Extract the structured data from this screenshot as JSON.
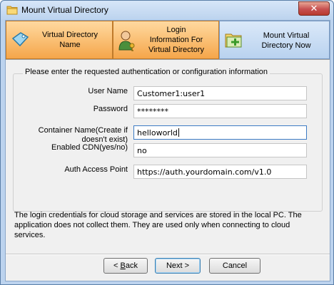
{
  "window": {
    "title": "Mount Virtual Directory",
    "close_glyph": "✕"
  },
  "steps": [
    {
      "label_line1": "Virtual Directory",
      "label_line2": "Name",
      "icon": "tag-icon",
      "state": "done"
    },
    {
      "label_line1": "Login",
      "label_line2": "Information For",
      "label_line3": "Virtual Directory",
      "icon": "user-key-icon",
      "state": "current"
    },
    {
      "label_line1": "Mount Virtual",
      "label_line2": "Directory Now",
      "icon": "folder-add-icon",
      "state": "pending"
    }
  ],
  "form": {
    "group_title": "Please enter the requested authentication or configuration information",
    "username_label": "User Name",
    "username_value": "Customer1:user1",
    "password_label": "Password",
    "password_value": "********",
    "container_label_line1": "Container Name(Create if",
    "container_label_line2": "doesn't exist)",
    "container_value": "helloworld",
    "cdn_label": "Enabled CDN(yes/no)",
    "cdn_value": "no",
    "auth_label": "Auth Access Point",
    "auth_value": "https://auth.yourdomain.com/v1.0"
  },
  "info_text": "The login credentials for cloud storage and services are stored in the local PC. The application does not collect them. They are used only when connecting to cloud services.",
  "buttons": {
    "back_prefix": "< ",
    "back_mnemonic": "B",
    "back_rest": "ack",
    "next_label": "Next >",
    "cancel_label": "Cancel"
  },
  "colors": {
    "step_active": "#f5a64a",
    "step_pending": "#b9d2ef",
    "titlebar": "#bcd3ee",
    "close": "#c75050"
  }
}
